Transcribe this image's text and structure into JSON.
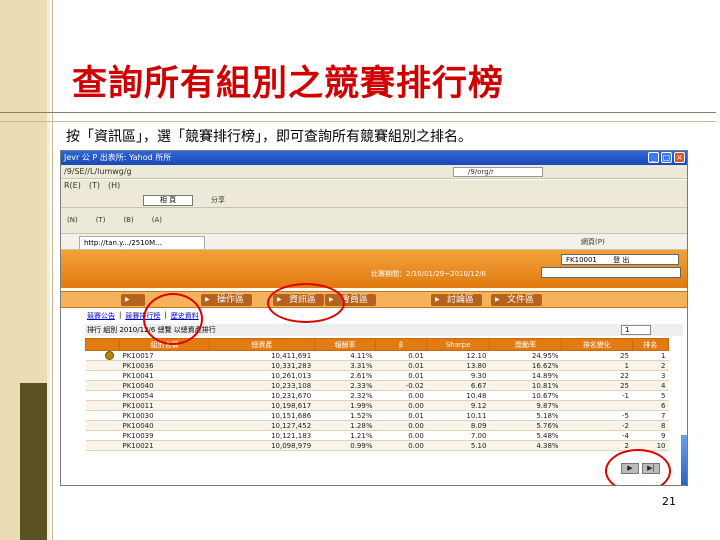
{
  "slide": {
    "title": "查詢所有組別之競賽排行榜",
    "caption": "按「資訊區」，選「競賽排行榜」，即可查詢所有競賽組別之排名。",
    "page_number": "21"
  },
  "browser": {
    "window_title": "Jevr 公 P 出表所: Yahod 所所",
    "address": "/9/SE//L/lumwg/g",
    "search_field": "/9/org/r",
    "menu": [
      "R(E)",
      "(T)",
      "(H)"
    ],
    "search_button": "相 頁",
    "toolbar_items": [
      "",
      "",
      "",
      "",
      "",
      "",
      "",
      "分享"
    ],
    "bookmarks": [
      "(N)",
      "(T)",
      "(B)",
      "(A)"
    ],
    "tab_label": "http://tan.y.../2510M...",
    "tab_right": "網頁(P)"
  },
  "site": {
    "logout_box": "FK10001",
    "logout_label": "登 出",
    "period_label": "比賽期間：2/10/01/29~2010/12/6",
    "site_select": "",
    "nav": [
      "",
      "操作區",
      "資訊區",
      "會員區",
      "討論區",
      "文件區"
    ],
    "subnav": [
      "競賽公告",
      "競賽排行榜",
      "歷史資料"
    ],
    "filter_text": "排行 組別 2010/12/6 總覽 以總資產排行",
    "filter_select": "1"
  },
  "ranking": {
    "columns": [
      "",
      "組別名稱",
      "總資產",
      "報酬率",
      "β",
      "Sharpe",
      "獎勵率",
      "排名變化",
      "排名"
    ],
    "rows": [
      {
        "team": "PK10017",
        "assets": "10,411,691",
        "ret": "4.11%",
        "beta": "0.01",
        "sharpe": "12.10",
        "award": "24.95%",
        "change": "25",
        "rank": "1",
        "medal": true
      },
      {
        "team": "PK10036",
        "assets": "10,331,283",
        "ret": "3.31%",
        "beta": "0.01",
        "sharpe": "13.80",
        "award": "16.62%",
        "change": "1",
        "rank": "2",
        "medal": false
      },
      {
        "team": "PK10041",
        "assets": "10,261,013",
        "ret": "2.61%",
        "beta": "0.01",
        "sharpe": "9.30",
        "award": "14.89%",
        "change": "22",
        "rank": "3",
        "medal": false
      },
      {
        "team": "PK10040",
        "assets": "10,233,108",
        "ret": "2.33%",
        "beta": "-0.02",
        "sharpe": "6.67",
        "award": "10.81%",
        "change": "25",
        "rank": "4",
        "medal": false
      },
      {
        "team": "PK10054",
        "assets": "10,231,670",
        "ret": "2.32%",
        "beta": "0.00",
        "sharpe": "10.48",
        "award": "10.67%",
        "change": "-1",
        "rank": "5",
        "medal": false
      },
      {
        "team": "PK10011",
        "assets": "10,198,617",
        "ret": "1.99%",
        "beta": "0.00",
        "sharpe": "9.12",
        "award": "9.87%",
        "change": "",
        "rank": "6",
        "medal": false
      },
      {
        "team": "PK10030",
        "assets": "10,151,686",
        "ret": "1.52%",
        "beta": "0.01",
        "sharpe": "10.11",
        "award": "5.18%",
        "change": "-5",
        "rank": "7",
        "medal": false
      },
      {
        "team": "PK10040",
        "assets": "10,127,452",
        "ret": "1.28%",
        "beta": "0.00",
        "sharpe": "8.09",
        "award": "5.76%",
        "change": "-2",
        "rank": "8",
        "medal": false
      },
      {
        "team": "PK10039",
        "assets": "10,121,183",
        "ret": "1.21%",
        "beta": "0.00",
        "sharpe": "7.00",
        "award": "5.48%",
        "change": "-4",
        "rank": "9",
        "medal": false
      },
      {
        "team": "PK10021",
        "assets": "10,098,979",
        "ret": "0.99%",
        "beta": "0.00",
        "sharpe": "5.10",
        "award": "4.38%",
        "change": "2",
        "rank": "10",
        "medal": false
      }
    ],
    "pager": [
      "▶",
      "▶|"
    ]
  }
}
